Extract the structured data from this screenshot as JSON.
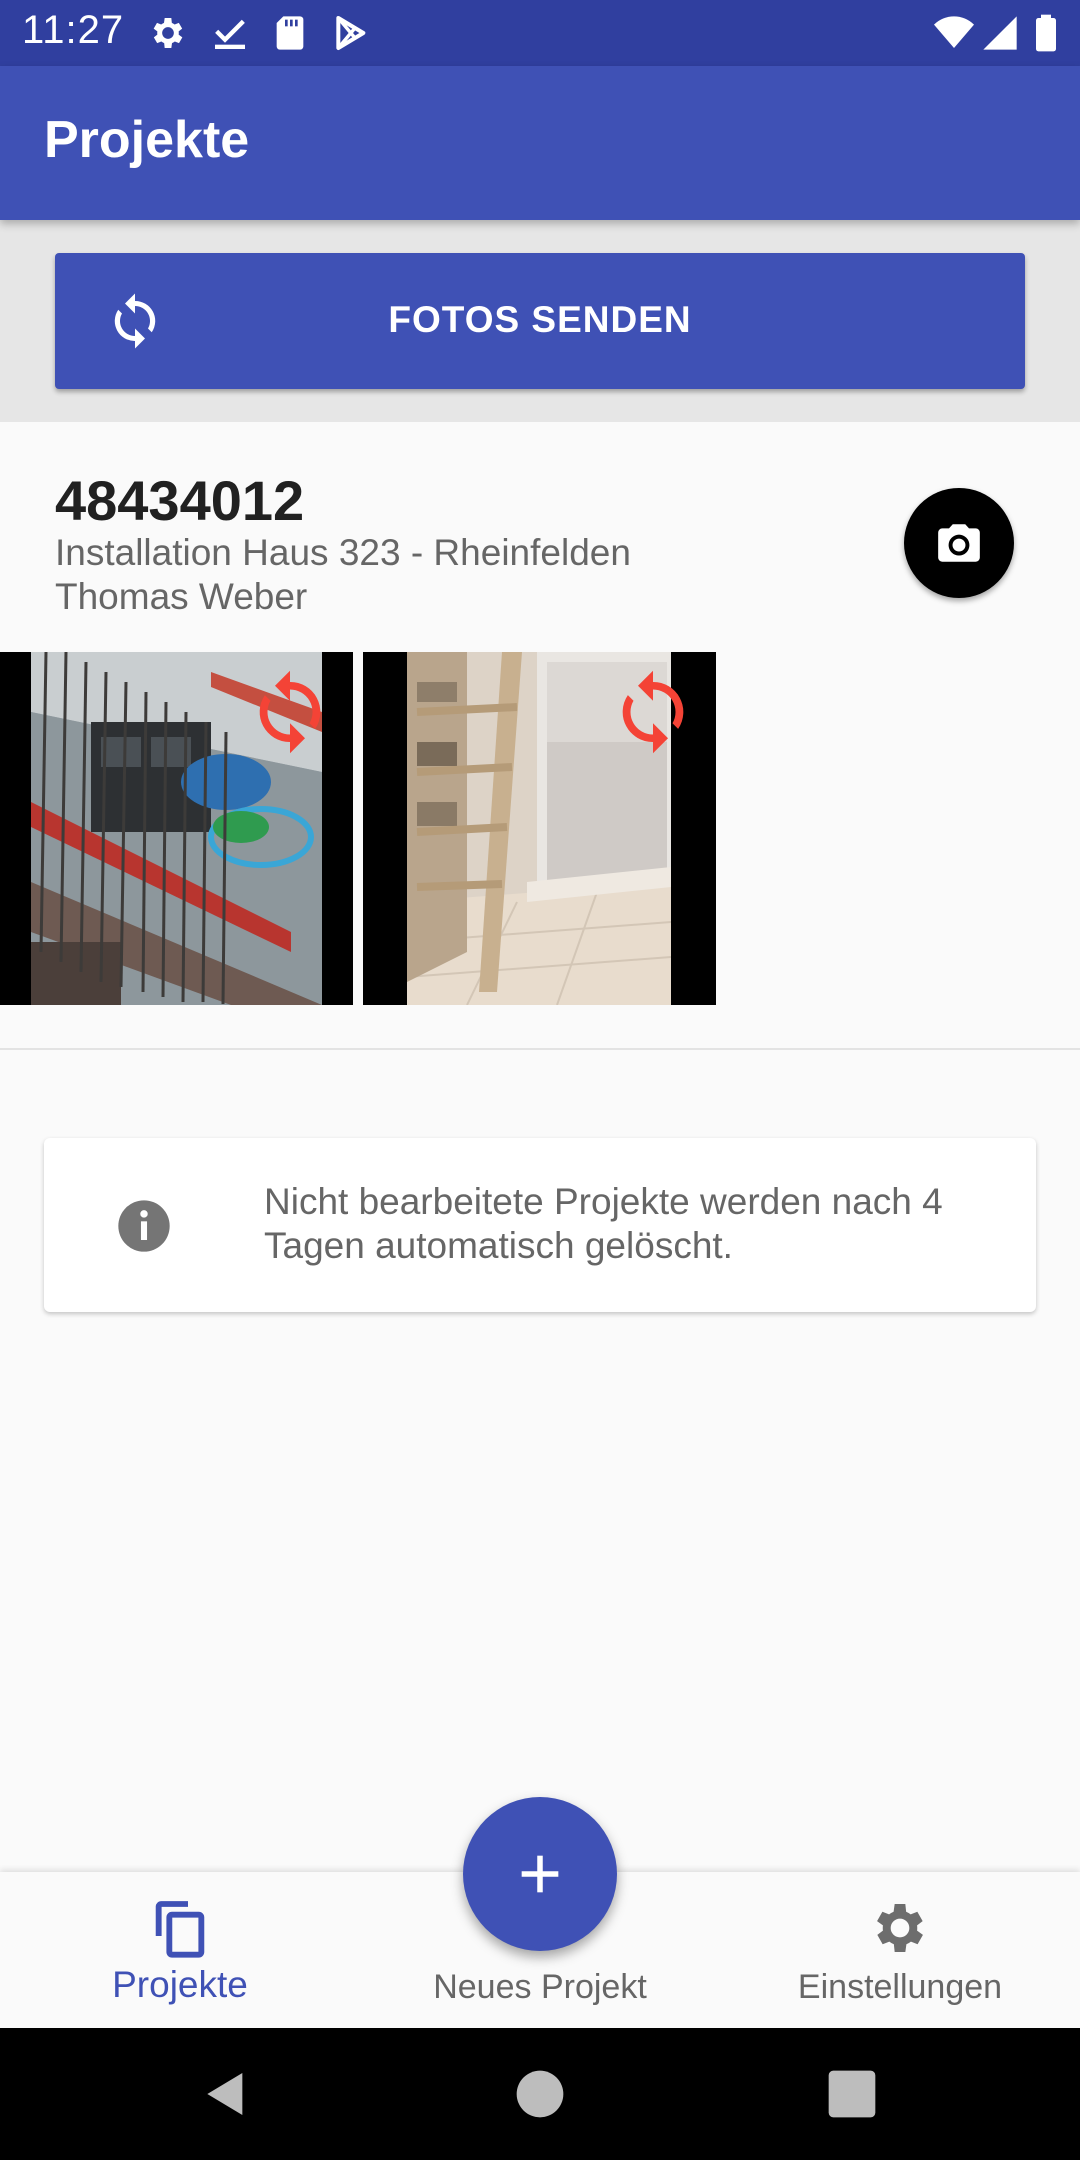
{
  "status_bar": {
    "time": "11:27",
    "icons": [
      "gear-icon",
      "check-download-icon",
      "sd-card-icon",
      "play-store-icon",
      "wifi-icon",
      "signal-icon",
      "battery-icon"
    ]
  },
  "app_bar": {
    "title": "Projekte"
  },
  "sync_button": {
    "label": "FOTOS SENDEN",
    "icon": "sync-icon"
  },
  "project": {
    "id": "48434012",
    "description": "Installation Haus 323 - Rheinfelden",
    "owner": "Thomas Weber",
    "camera_icon": "camera-icon",
    "photos": [
      {
        "subject": "construction-site",
        "status_icon": "sync-pending-icon",
        "status_color": "#f44336"
      },
      {
        "subject": "interior-shelf",
        "status_icon": "sync-pending-icon",
        "status_color": "#f44336"
      }
    ]
  },
  "info_card": {
    "icon": "info-icon",
    "text": "Nicht bearbeitete Projekte werden nach 4 Tagen automatisch gelöscht."
  },
  "bottom_nav": {
    "items": [
      {
        "label": "Projekte",
        "icon": "copy-icon",
        "active": true
      },
      {
        "label": "Neues Projekt",
        "icon": "plus-icon",
        "active": false
      },
      {
        "label": "Einstellungen",
        "icon": "gear-icon",
        "active": false
      }
    ]
  },
  "colors": {
    "primary": "#3f51b5",
    "primary_dark": "#303f9f",
    "sync_pending": "#f44336",
    "secondary_text": "#666666"
  }
}
